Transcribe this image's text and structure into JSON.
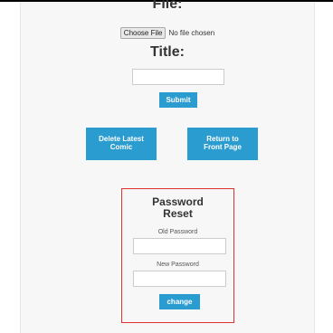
{
  "upload": {
    "file_heading": "File:",
    "choose_file_label": "Choose File",
    "file_status": "No file chosen",
    "title_heading": "Title:",
    "title_value": "",
    "submit_label": "Submit"
  },
  "actions": {
    "delete_latest_comic_label": "Delete Latest Comic",
    "return_front_page_label": "Return to Front Page"
  },
  "password_reset": {
    "title": "Password Reset",
    "old_password_label": "Old Password",
    "old_password_value": "",
    "new_password_label": "New Password",
    "new_password_value": "",
    "change_label": "change"
  },
  "colors": {
    "accent": "#2a9cd0",
    "reset_border": "#e03030",
    "panel_bg": "#f7f7f7"
  }
}
